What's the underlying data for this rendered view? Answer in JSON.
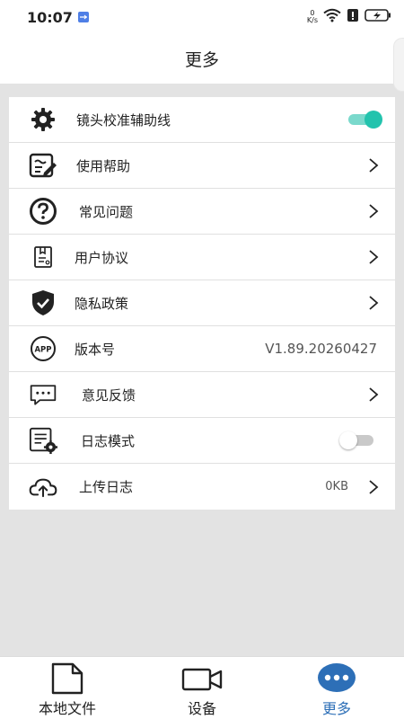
{
  "status_bar": {
    "time": "10:07",
    "speed_value": "0",
    "speed_unit": "K/s"
  },
  "header": {
    "title": "更多"
  },
  "settings": [
    {
      "label": "镜头校准辅助线",
      "icon": "gear-icon",
      "toggle": "on"
    },
    {
      "label": "使用帮助",
      "icon": "help-edit-icon"
    },
    {
      "label": "常见问题",
      "icon": "question-icon"
    },
    {
      "label": "用户协议",
      "icon": "agreement-icon"
    },
    {
      "label": "隐私政策",
      "icon": "shield-check-icon"
    },
    {
      "label": "版本号",
      "icon": "app-icon",
      "value": "V1.89.20260427"
    },
    {
      "label": "意见反馈",
      "icon": "feedback-icon"
    },
    {
      "label": "日志模式",
      "icon": "log-settings-icon",
      "toggle": "off"
    },
    {
      "label": "上传日志",
      "icon": "cloud-upload-icon",
      "value": "0KB"
    }
  ],
  "tabs": [
    {
      "label": "本地文件",
      "icon": "file-icon"
    },
    {
      "label": "设备",
      "icon": "camera-icon"
    },
    {
      "label": "更多",
      "icon": "more-icon",
      "active": true
    }
  ],
  "colors": {
    "accent": "#22c3ad",
    "active_tab": "#2d6fb7",
    "background": "#e3e3e3"
  }
}
